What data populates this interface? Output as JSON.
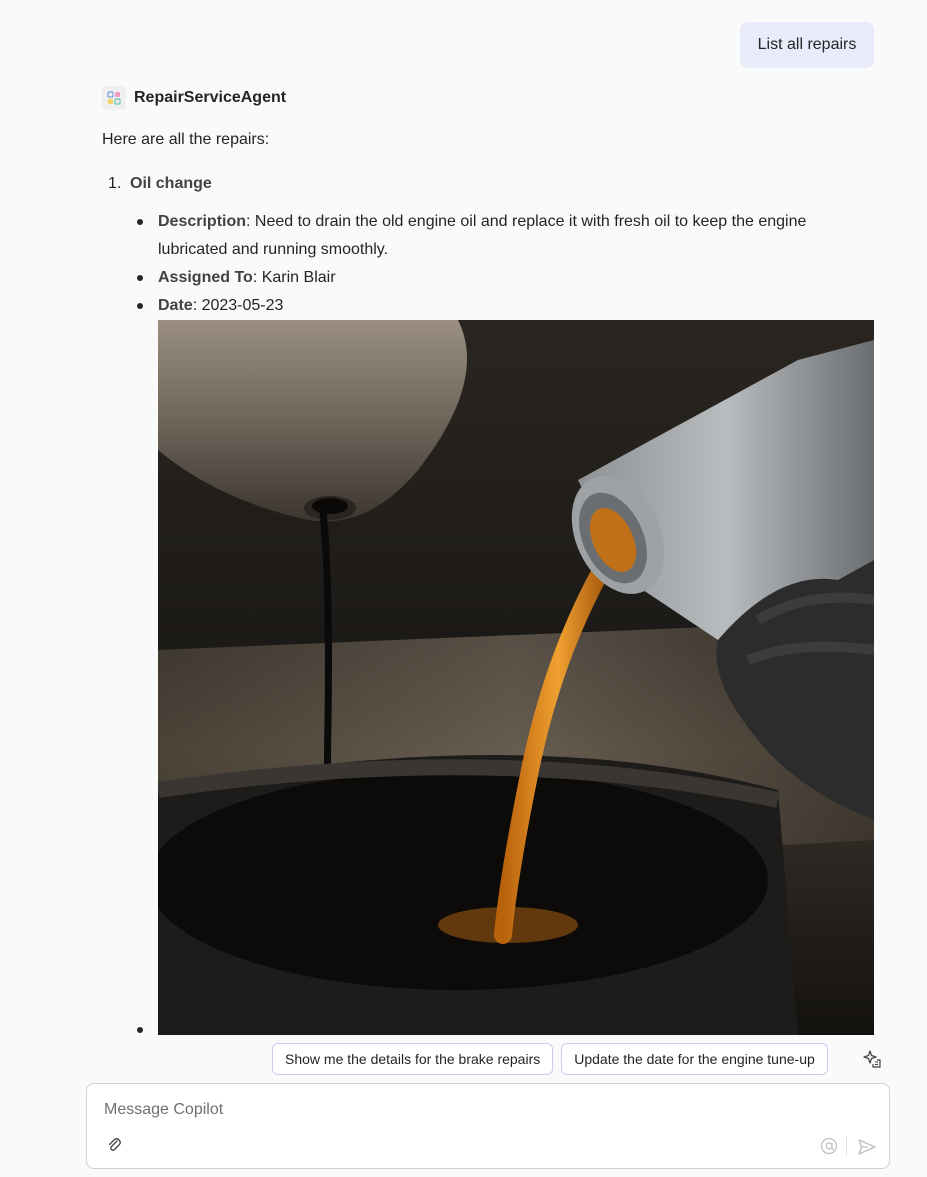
{
  "user_message": "List all repairs",
  "agent": {
    "name": "RepairServiceAgent",
    "intro": "Here are all the repairs:"
  },
  "repairs": [
    {
      "number": "1.",
      "title": "Oil change",
      "description_label": "Description",
      "description": "Need to drain the old engine oil and replace it with fresh oil to keep the engine lubricated and running smoothly.",
      "assigned_label": "Assigned To",
      "assigned_to": "Karin Blair",
      "date_label": "Date",
      "date": "2023-05-23",
      "image_icon": "oil-change-photo"
    }
  ],
  "suggestions": [
    "Show me the details for the brake repairs",
    "Update the date for the engine tune-up"
  ],
  "composer": {
    "placeholder": "Message Copilot"
  },
  "icons": {
    "avatar": "agent-avatar-icon",
    "sparkle": "sparkle-icon",
    "attach": "paperclip-icon",
    "mention": "at-icon",
    "send": "send-icon"
  },
  "colors": {
    "user_bubble": "#e8ebfa",
    "chip_border": "#c7cdf2",
    "background": "#fafafa"
  }
}
